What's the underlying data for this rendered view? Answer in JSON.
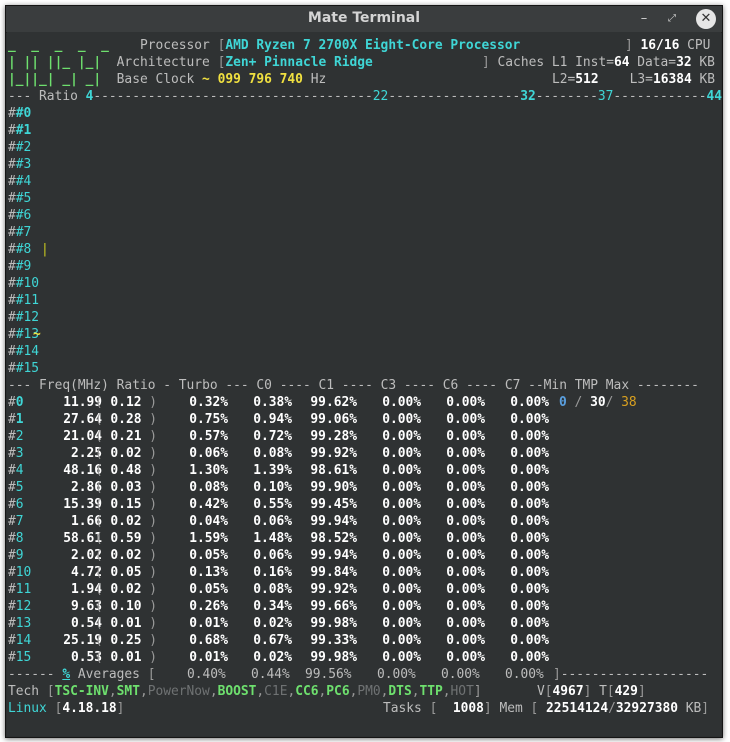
{
  "window": {
    "title": "Mate Terminal"
  },
  "header": {
    "logo": [
      "_  _  _  _  _",
      "| || ||_ |_|",
      "|_||_| _| _|"
    ],
    "processor_label": "Processor",
    "processor": "AMD Ryzen 7 2700X Eight-Core Processor",
    "cpu_count": "16/16",
    "cpu_label": "CPU",
    "arch_label": "Architecture",
    "arch": "Zen+ Pinnacle Ridge",
    "caches_label": "Caches",
    "l1_inst_label": "L1 Inst=",
    "l1_inst": "64",
    "data_label": "Data=",
    "l1_data": "32",
    "kb": "KB",
    "base_clock_label": "Base Clock",
    "base_clock": "~ 099 796 740",
    "hz": "Hz",
    "l2_label": "L2=",
    "l2": "512",
    "l3_label": "L3=",
    "l3": "16384"
  },
  "ratio_bar": {
    "label": "Ratio",
    "marks": [
      "4",
      "22",
      "32",
      "37",
      "44"
    ],
    "rows": [
      "#0",
      "#1",
      "#2",
      "#3",
      "#4",
      "#5",
      "#6",
      "#7",
      "#8",
      "#9",
      "#10",
      "#11",
      "#12",
      "#13",
      "#14",
      "#15"
    ],
    "row8_mark": "|",
    "row13_mark": "~"
  },
  "table": {
    "headers": [
      "Freq(MHz)",
      "Ratio",
      "Turbo",
      "C0",
      "C1",
      "C3",
      "C6",
      "C7",
      "Min",
      "TMP",
      "Max"
    ],
    "rows": [
      {
        "id": "#0",
        "freq": "11.99",
        "ratio": "0.12",
        "turbo": "0.32%",
        "c0": "0.38%",
        "c1": "99.62%",
        "c3": "0.00%",
        "c6": "0.00%",
        "c7": "0.00%"
      },
      {
        "id": "#1",
        "freq": "27.64",
        "ratio": "0.28",
        "turbo": "0.75%",
        "c0": "0.94%",
        "c1": "99.06%",
        "c3": "0.00%",
        "c6": "0.00%",
        "c7": "0.00%"
      },
      {
        "id": "#2",
        "freq": "21.04",
        "ratio": "0.21",
        "turbo": "0.57%",
        "c0": "0.72%",
        "c1": "99.28%",
        "c3": "0.00%",
        "c6": "0.00%",
        "c7": "0.00%"
      },
      {
        "id": "#3",
        "freq": "2.25",
        "ratio": "0.02",
        "turbo": "0.06%",
        "c0": "0.08%",
        "c1": "99.92%",
        "c3": "0.00%",
        "c6": "0.00%",
        "c7": "0.00%"
      },
      {
        "id": "#4",
        "freq": "48.16",
        "ratio": "0.48",
        "turbo": "1.30%",
        "c0": "1.39%",
        "c1": "98.61%",
        "c3": "0.00%",
        "c6": "0.00%",
        "c7": "0.00%"
      },
      {
        "id": "#5",
        "freq": "2.86",
        "ratio": "0.03",
        "turbo": "0.08%",
        "c0": "0.10%",
        "c1": "99.90%",
        "c3": "0.00%",
        "c6": "0.00%",
        "c7": "0.00%"
      },
      {
        "id": "#6",
        "freq": "15.39",
        "ratio": "0.15",
        "turbo": "0.42%",
        "c0": "0.55%",
        "c1": "99.45%",
        "c3": "0.00%",
        "c6": "0.00%",
        "c7": "0.00%"
      },
      {
        "id": "#7",
        "freq": "1.66",
        "ratio": "0.02",
        "turbo": "0.04%",
        "c0": "0.06%",
        "c1": "99.94%",
        "c3": "0.00%",
        "c6": "0.00%",
        "c7": "0.00%"
      },
      {
        "id": "#8",
        "freq": "58.61",
        "ratio": "0.59",
        "turbo": "1.59%",
        "c0": "1.48%",
        "c1": "98.52%",
        "c3": "0.00%",
        "c6": "0.00%",
        "c7": "0.00%"
      },
      {
        "id": "#9",
        "freq": "2.02",
        "ratio": "0.02",
        "turbo": "0.05%",
        "c0": "0.06%",
        "c1": "99.94%",
        "c3": "0.00%",
        "c6": "0.00%",
        "c7": "0.00%"
      },
      {
        "id": "#10",
        "freq": "4.72",
        "ratio": "0.05",
        "turbo": "0.13%",
        "c0": "0.16%",
        "c1": "99.84%",
        "c3": "0.00%",
        "c6": "0.00%",
        "c7": "0.00%"
      },
      {
        "id": "#11",
        "freq": "1.94",
        "ratio": "0.02",
        "turbo": "0.05%",
        "c0": "0.08%",
        "c1": "99.92%",
        "c3": "0.00%",
        "c6": "0.00%",
        "c7": "0.00%"
      },
      {
        "id": "#12",
        "freq": "9.63",
        "ratio": "0.10",
        "turbo": "0.26%",
        "c0": "0.34%",
        "c1": "99.66%",
        "c3": "0.00%",
        "c6": "0.00%",
        "c7": "0.00%"
      },
      {
        "id": "#13",
        "freq": "0.54",
        "ratio": "0.01",
        "turbo": "0.01%",
        "c0": "0.02%",
        "c1": "99.98%",
        "c3": "0.00%",
        "c6": "0.00%",
        "c7": "0.00%"
      },
      {
        "id": "#14",
        "freq": "25.19",
        "ratio": "0.25",
        "turbo": "0.68%",
        "c0": "0.67%",
        "c1": "99.33%",
        "c3": "0.00%",
        "c6": "0.00%",
        "c7": "0.00%"
      },
      {
        "id": "#15",
        "freq": "0.53",
        "ratio": "0.01",
        "turbo": "0.01%",
        "c0": "0.02%",
        "c1": "99.98%",
        "c3": "0.00%",
        "c6": "0.00%",
        "c7": "0.00%"
      }
    ],
    "temp": {
      "min": "0",
      "tmp": "30",
      "max": "38"
    },
    "averages": {
      "label": "Averages",
      "pct": "%",
      "turbo": "0.40%",
      "c0": "0.44%",
      "c1": "99.56%",
      "c3": "0.00%",
      "c6": "0.00%",
      "c7": "0.00%"
    }
  },
  "footer": {
    "tech_label": "Tech",
    "tech_items": [
      {
        "label": "TSC-INV",
        "on": true
      },
      {
        "label": "SMT",
        "on": true
      },
      {
        "label": "PowerNow",
        "on": false
      },
      {
        "label": "BOOST",
        "on": true
      },
      {
        "label": "C1E",
        "on": false
      },
      {
        "label": "CC6",
        "on": true
      },
      {
        "label": "PC6",
        "on": true
      },
      {
        "label": "PM0",
        "on": false
      },
      {
        "label": "DTS",
        "on": true
      },
      {
        "label": "TTP",
        "on": true
      },
      {
        "label": "HOT",
        "on": false
      }
    ],
    "v_label": "V",
    "v_value": "4967",
    "t_label": "T",
    "t_value": "429",
    "os": "Linux",
    "kernel": "4.18.18",
    "tasks_label": "Tasks",
    "tasks": "1008",
    "mem_label": "Mem",
    "mem_used": "22514124",
    "mem_total": "32927380",
    "mem_unit": "KB"
  }
}
